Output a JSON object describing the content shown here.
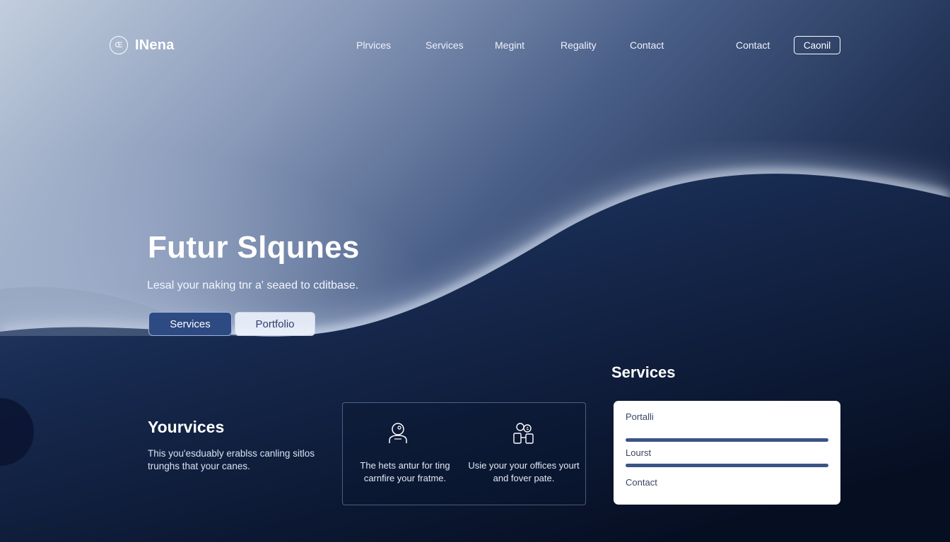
{
  "brand": {
    "logo_glyph": "Œ",
    "name": "INena"
  },
  "nav": {
    "links": [
      "Plrvices",
      "Services",
      "Megint",
      "Regality",
      "Contact",
      "Contact"
    ],
    "cta_label": "Caonil"
  },
  "hero": {
    "title": "Futur Slqunes",
    "subtitle": "Lesal your naking tnr a' seaed to cditbase.",
    "primary_button": "Services",
    "secondary_button": "Portfolio"
  },
  "yourvices": {
    "title": "Yourvices",
    "body": "This you'esduably erablss canling sitlos trunghs that your canes."
  },
  "features": [
    {
      "icon": "person-icon",
      "text": "The hets antur for ting carnfire your fratme."
    },
    {
      "icon": "team-icon",
      "text": "Usie your your offices yourt and fover pate."
    }
  ],
  "services_panel": {
    "title": "Services",
    "items": [
      {
        "label": "Portalli"
      },
      {
        "label": "Lourst"
      },
      {
        "label": "Contact"
      }
    ]
  },
  "colors": {
    "background_dark": "#0b1630",
    "accent_blue": "#2d4a82",
    "bar_blue": "#3b5486",
    "panel_bg": "#ffffff"
  }
}
